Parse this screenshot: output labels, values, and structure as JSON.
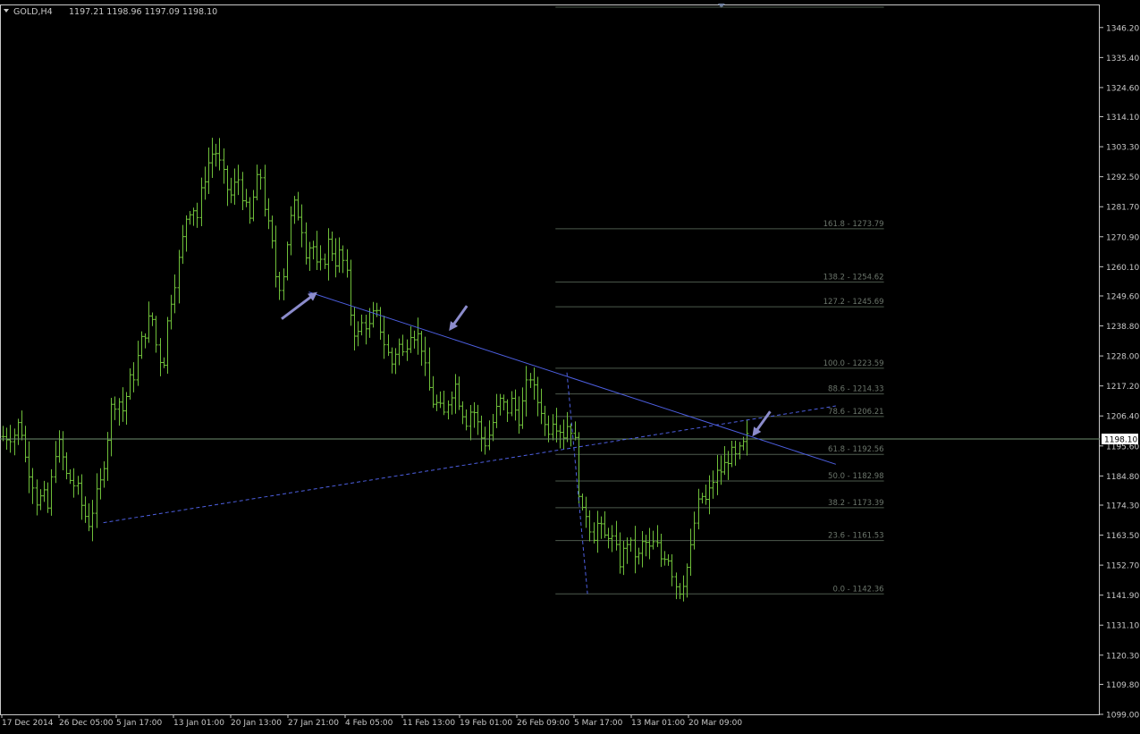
{
  "header": {
    "symbol": "GOLD,H4",
    "ohlc": "1197.21 1198.96 1197.09 1198.10"
  },
  "colors": {
    "background": "#000000",
    "frame": "#c8c8c8",
    "candle": "#6fbf3a",
    "trendline": "#4d5fe0",
    "fib": "#4d5a4d",
    "fib_label": "#6b756b",
    "bid_line": "#6f8f6f",
    "arrow": "#8c8ccc",
    "axis_text": "#c8c8c8",
    "price_tag_bg": "#ffffff",
    "price_tag_text": "#000000"
  },
  "chart_data": {
    "type": "candlestick",
    "title": "GOLD,H4",
    "ylim": [
      1099.0,
      1354.5
    ],
    "price_ticks": [
      "1346.20",
      "1335.40",
      "1324.60",
      "1314.10",
      "1303.30",
      "1292.50",
      "1281.70",
      "1270.90",
      "1260.10",
      "1249.60",
      "1238.80",
      "1228.00",
      "1217.20",
      "1206.40",
      "1195.60",
      "1184.80",
      "1174.30",
      "1163.50",
      "1152.70",
      "1141.90",
      "1131.10",
      "1120.30",
      "1109.80",
      "1099.00"
    ],
    "time_ticks": [
      "17 Dec 2014",
      "26 Dec 05:00",
      "5 Jan 17:00",
      "13 Jan 01:00",
      "20 Jan 13:00",
      "27 Jan 21:00",
      "4 Feb 05:00",
      "11 Feb 13:00",
      "19 Feb 01:00",
      "26 Feb 09:00",
      "5 Mar 17:00",
      "13 Mar 01:00",
      "20 Mar 09:00"
    ],
    "current_price": "1198.10",
    "close_path": [
      [
        0,
        1199
      ],
      [
        2,
        1200
      ],
      [
        3,
        1205
      ],
      [
        4,
        1190
      ],
      [
        5,
        1185
      ],
      [
        6,
        1175
      ],
      [
        7,
        1178
      ],
      [
        8,
        1172
      ],
      [
        9,
        1194
      ],
      [
        10,
        1196
      ],
      [
        11,
        1185
      ],
      [
        12,
        1183
      ],
      [
        13,
        1180
      ],
      [
        14,
        1172
      ],
      [
        15,
        1168
      ],
      [
        16,
        1175
      ],
      [
        17,
        1182
      ],
      [
        18,
        1195
      ],
      [
        19,
        1210
      ],
      [
        20,
        1213
      ],
      [
        21,
        1208
      ],
      [
        22,
        1218
      ],
      [
        23,
        1222
      ],
      [
        24,
        1232
      ],
      [
        25,
        1238
      ],
      [
        26,
        1243
      ],
      [
        27,
        1229
      ],
      [
        28,
        1225
      ],
      [
        29,
        1245
      ],
      [
        30,
        1255
      ],
      [
        31,
        1265
      ],
      [
        32,
        1278
      ],
      [
        33,
        1283
      ],
      [
        34,
        1278
      ],
      [
        35,
        1291
      ],
      [
        36,
        1298
      ],
      [
        37,
        1303
      ],
      [
        38,
        1296
      ],
      [
        39,
        1289
      ],
      [
        40,
        1285
      ],
      [
        41,
        1293
      ],
      [
        42,
        1285
      ],
      [
        43,
        1275
      ],
      [
        44,
        1288
      ],
      [
        45,
        1294
      ],
      [
        46,
        1278
      ],
      [
        47,
        1268
      ],
      [
        48,
        1252
      ],
      [
        49,
        1258
      ],
      [
        50,
        1275
      ],
      [
        51,
        1282
      ],
      [
        52,
        1278
      ],
      [
        53,
        1265
      ],
      [
        54,
        1270
      ],
      [
        55,
        1258
      ],
      [
        56,
        1262
      ],
      [
        57,
        1270
      ],
      [
        58,
        1262
      ],
      [
        59,
        1265
      ],
      [
        60,
        1258
      ],
      [
        61,
        1239
      ],
      [
        62,
        1235
      ],
      [
        63,
        1241
      ],
      [
        64,
        1238
      ],
      [
        65,
        1244
      ],
      [
        66,
        1238
      ],
      [
        67,
        1230
      ],
      [
        68,
        1225
      ],
      [
        69,
        1233
      ],
      [
        70,
        1228
      ],
      [
        71,
        1238
      ],
      [
        72,
        1236
      ],
      [
        73,
        1234
      ],
      [
        74,
        1220
      ],
      [
        75,
        1212
      ],
      [
        76,
        1210
      ],
      [
        77,
        1206
      ],
      [
        78,
        1214
      ],
      [
        79,
        1218
      ],
      [
        80,
        1210
      ],
      [
        81,
        1205
      ],
      [
        82,
        1210
      ],
      [
        83,
        1203
      ],
      [
        84,
        1196
      ],
      [
        85,
        1200
      ],
      [
        86,
        1207
      ],
      [
        87,
        1212
      ],
      [
        88,
        1208
      ],
      [
        89,
        1212
      ],
      [
        90,
        1205
      ],
      [
        91,
        1212
      ],
      [
        92,
        1222
      ],
      [
        93,
        1213
      ],
      [
        94,
        1210
      ],
      [
        95,
        1200
      ],
      [
        96,
        1206
      ],
      [
        97,
        1203
      ],
      [
        98,
        1200
      ],
      [
        99,
        1205
      ],
      [
        100,
        1196
      ],
      [
        101,
        1170
      ],
      [
        102,
        1172
      ],
      [
        103,
        1163
      ],
      [
        104,
        1168
      ],
      [
        105,
        1162
      ],
      [
        106,
        1165
      ],
      [
        107,
        1158
      ],
      [
        108,
        1153
      ],
      [
        109,
        1162
      ],
      [
        110,
        1158
      ],
      [
        111,
        1155
      ],
      [
        112,
        1162
      ],
      [
        113,
        1158
      ],
      [
        114,
        1161
      ],
      [
        115,
        1155
      ],
      [
        116,
        1158
      ],
      [
        117,
        1150
      ],
      [
        118,
        1143
      ],
      [
        119,
        1148
      ],
      [
        120,
        1155
      ],
      [
        121,
        1170
      ],
      [
        122,
        1178
      ],
      [
        123,
        1175
      ],
      [
        124,
        1183
      ],
      [
        125,
        1186
      ],
      [
        126,
        1188
      ],
      [
        127,
        1193
      ],
      [
        128,
        1191
      ],
      [
        129,
        1194
      ],
      [
        130,
        1198
      ]
    ],
    "trendlines": [
      {
        "style": "solid",
        "from": [
          53.5,
          1251.0
        ],
        "to": [
          145.6,
          1189.0
        ]
      },
      {
        "style": "dashed",
        "from": [
          17.6,
          1168.0
        ],
        "to": [
          145.6,
          1210.0
        ]
      },
      {
        "style": "dashed",
        "from": [
          98.6,
          1222.0
        ],
        "to": [
          102.2,
          1142.36
        ]
      }
    ],
    "fibonacci": [
      {
        "label": "161.8 - 1273.79",
        "price": 1273.79
      },
      {
        "label": "138.2 - 1254.62",
        "price": 1254.62
      },
      {
        "label": "127.2 - 1245.69",
        "price": 1245.69
      },
      {
        "label": "100.0 - 1223.59",
        "price": 1223.59
      },
      {
        "label": "88.6 - 1214.33",
        "price": 1214.33
      },
      {
        "label": "78.6 - 1206.21",
        "price": 1206.21
      },
      {
        "label": "61.8 - 1192.56",
        "price": 1192.56
      },
      {
        "label": "50.0 - 1182.98",
        "price": 1182.98
      },
      {
        "label": "38.2 - 1173.39",
        "price": 1173.39
      },
      {
        "label": "23.6  - 1161.53",
        "price": 1161.53
      },
      {
        "label": "0.0 - 1142.36",
        "price": 1142.36
      }
    ],
    "fib_range": [
      96.6,
      154.0
    ],
    "arrows": [
      {
        "tip": [
          55,
          1251.0
        ],
        "dir": "up-right"
      },
      {
        "tip": [
          78,
          1237.0
        ],
        "dir": "down-left"
      },
      {
        "tip": [
          131,
          1199.0
        ],
        "dir": "down-left"
      }
    ]
  }
}
